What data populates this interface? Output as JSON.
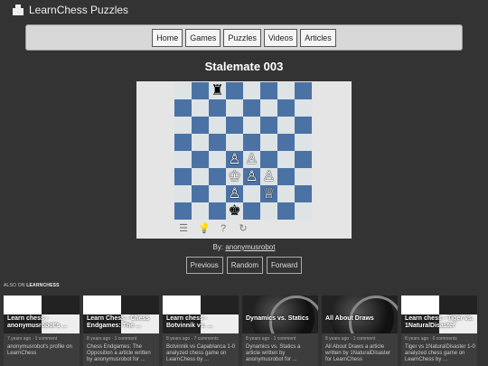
{
  "header": {
    "brand": "LearnChess Puzzles",
    "logo_icon": "puzzle-piece-icon"
  },
  "nav": {
    "items": [
      "Home",
      "Games",
      "Puzzles",
      "Videos",
      "Articles"
    ]
  },
  "puzzle": {
    "title": "Stalemate 003",
    "board": [
      [
        "",
        "",
        "bk",
        "",
        "",
        "",
        "",
        ""
      ],
      [
        "",
        "",
        "",
        "",
        "",
        "",
        "",
        ""
      ],
      [
        "",
        "",
        "",
        "",
        "",
        "",
        "",
        ""
      ],
      [
        "",
        "",
        "",
        "",
        "",
        "",
        "",
        ""
      ],
      [
        "",
        "",
        "",
        "wp",
        "wp",
        "",
        "",
        ""
      ],
      [
        "",
        "",
        "",
        "wk",
        "wp",
        "wp",
        "",
        ""
      ],
      [
        "",
        "",
        "",
        "wp",
        "",
        "bq",
        "",
        ""
      ],
      [
        "",
        "",
        "",
        "bk2",
        "",
        "",
        "",
        ""
      ]
    ],
    "pieces_note_icons": {
      "bk": "black-rook-icon",
      "wp": "white-pawn-icon",
      "wk": "white-king-icon",
      "bq": "black-queen-icon",
      "bk2": "black-king-icon"
    },
    "colors": {
      "light": "#dee3e6",
      "dark": "#4b72a4"
    }
  },
  "byline": {
    "prefix": "By:",
    "author": "anonymusrobot"
  },
  "pager": {
    "previous": "Previous",
    "random": "Random",
    "forward": "Forward"
  },
  "also": {
    "prefix": "ALSO ON",
    "site": "LEARNCHESS"
  },
  "cards": [
    {
      "title": "Learn chess - anonymusrobot's ...",
      "meta": "7 years ago · 1 comment",
      "desc": "anonymusrobot's profile on LearnChess"
    },
    {
      "title": "Learn Chess - Chess Endgames: The ...",
      "meta": "8 years ago · 1 comment",
      "desc": "Chess Endgames: The Opposition a article written by anonymusrobot for ..."
    },
    {
      "title": "Learn chess - Botvinnik vs. ...",
      "meta": "8 years ago · 7 comments",
      "desc": "Botvinnik vs Capablanca 1-0 analyzed chess game on LearnChess by ..."
    },
    {
      "title": "Dynamics vs. Statics",
      "meta": "8 years ago · 1 comment",
      "desc": "Dynamics vs. Statics a article written by anonymusrobot for ..."
    },
    {
      "title": "All About Draws",
      "meta": "8 years ago · 1 comment",
      "desc": "All About Draws a article written by 1NaturalDisaster for LearnChess"
    },
    {
      "title": "Learn chess - Tiger vs. 1NaturalDisaster",
      "meta": "8 years ago · 6 comments",
      "desc": "Tiger vs 1NaturalDisaster 1-0 analyzed chess game on LearnChess by ..."
    }
  ]
}
